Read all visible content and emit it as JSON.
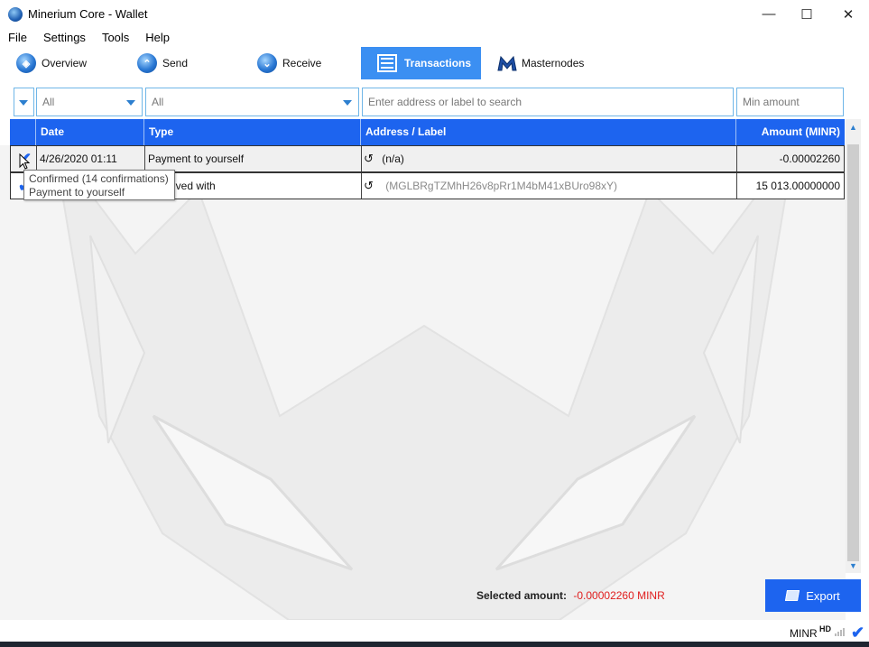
{
  "window": {
    "title": "Minerium Core - Wallet",
    "minimize": "—",
    "maximize": "☐",
    "close": "✕"
  },
  "menu": [
    "File",
    "Settings",
    "Tools",
    "Help"
  ],
  "toolbar": {
    "overview": "Overview",
    "send": "Send",
    "receive": "Receive",
    "transactions": "Transactions",
    "masternodes": "Masternodes"
  },
  "filters": {
    "date": "All",
    "type": "All",
    "search_placeholder": "Enter address or label to search",
    "amount_placeholder": "Min amount"
  },
  "table": {
    "headers": {
      "date": "Date",
      "type": "Type",
      "address": "Address / Label",
      "amount": "Amount (MINR)"
    },
    "rows": [
      {
        "date": "4/26/2020 01:11",
        "type": "Payment to yourself",
        "address": "(n/a)",
        "amount": "-0.00002260"
      },
      {
        "date": "",
        "type": "Received with",
        "address": "(MGLBRgTZMhH26v8pRr1M4bM41xBUro98xY)",
        "amount": "15 013.00000000"
      }
    ]
  },
  "tooltip": {
    "line1": "Confirmed (14 confirmations)",
    "line2": "Payment to yourself"
  },
  "footer": {
    "selected_label": "Selected amount:",
    "selected_value": "-0.00002260 MINR",
    "export": "Export"
  },
  "status": {
    "unit": "MINR",
    "hd": "HD"
  },
  "colors": {
    "accent": "#1d64ef",
    "negative": "#e01e1e"
  }
}
